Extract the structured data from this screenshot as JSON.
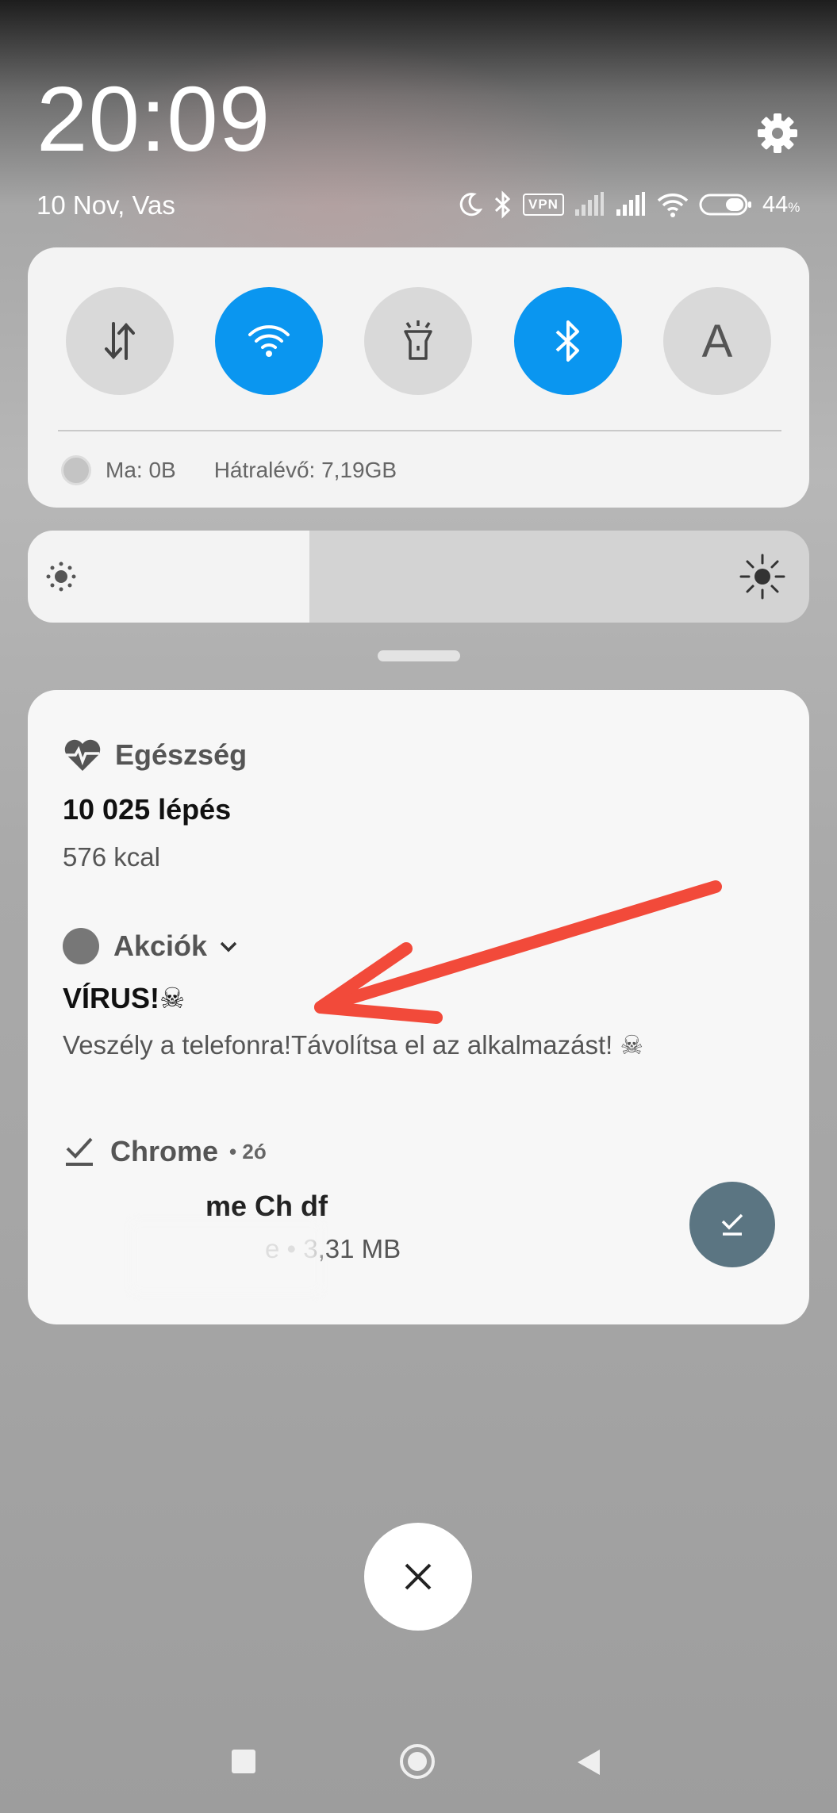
{
  "status_bar": {
    "time": "20:09",
    "date": "10 Nov, Vas",
    "vpn_label": "VPN",
    "battery_percent": "44",
    "battery_unit": "%",
    "icons": [
      "moon-icon",
      "bluetooth-icon",
      "vpn-icon",
      "signal-icon",
      "signal-icon",
      "wifi-icon",
      "battery-icon"
    ]
  },
  "quick_settings": {
    "tiles": [
      {
        "name": "mobile-data",
        "active": false
      },
      {
        "name": "wifi",
        "active": true
      },
      {
        "name": "flashlight",
        "active": false
      },
      {
        "name": "bluetooth",
        "active": true
      },
      {
        "name": "auto-brightness",
        "active": false,
        "label": "A"
      }
    ],
    "data_today": "Ma: 0B",
    "data_remaining": "Hátralévő: 7,19GB",
    "accent_color": "#0a96f0"
  },
  "brightness": {
    "level": 0.36
  },
  "notifications": [
    {
      "app": "Egészség",
      "title": "10 025 lépés",
      "text": "576 kcal"
    },
    {
      "app": "Akciók",
      "title": "VÍRUS!☠",
      "text": "Veszély a telefonra!Távolítsa el az alkalmazást! ☠"
    },
    {
      "app": "Chrome",
      "time": "• 2ó",
      "title": "me  Ch   df",
      "text": "e • 3,31 MB"
    }
  ],
  "annotation": {
    "arrow_color": "#f24a3a"
  }
}
